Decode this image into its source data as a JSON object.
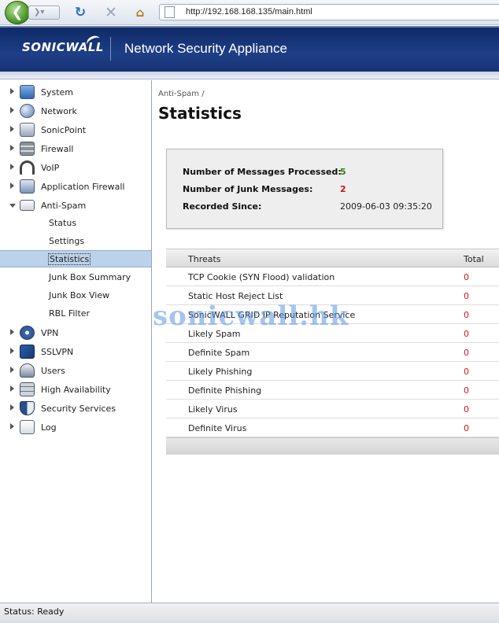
{
  "browser": {
    "address": "http://192.168.168.135/main.html"
  },
  "header": {
    "logo": "SONICWALL",
    "title": "Network Security Appliance"
  },
  "sidebar": {
    "items": [
      {
        "label": "System",
        "icon": "monitor-icon",
        "expanded": false
      },
      {
        "label": "Network",
        "icon": "globe-icon",
        "expanded": false
      },
      {
        "label": "SonicPoint",
        "icon": "access-point-icon",
        "expanded": false
      },
      {
        "label": "Firewall",
        "icon": "firewall-icon",
        "expanded": false
      },
      {
        "label": "VoIP",
        "icon": "headset-icon",
        "expanded": false
      },
      {
        "label": "Application Firewall",
        "icon": "app-firewall-icon",
        "expanded": false
      },
      {
        "label": "Anti-Spam",
        "icon": "mail-icon",
        "expanded": true
      },
      {
        "label": "VPN",
        "icon": "lock-icon",
        "expanded": false
      },
      {
        "label": "SSLVPN",
        "icon": "sslvpn-icon",
        "expanded": false
      },
      {
        "label": "Users",
        "icon": "users-icon",
        "expanded": false
      },
      {
        "label": "High Availability",
        "icon": "server-icon",
        "expanded": false
      },
      {
        "label": "Security Services",
        "icon": "shield-icon",
        "expanded": false
      },
      {
        "label": "Log",
        "icon": "log-search-icon",
        "expanded": false
      }
    ],
    "antispam_children": [
      {
        "label": "Status",
        "active": false
      },
      {
        "label": "Settings",
        "active": false
      },
      {
        "label": "Statistics",
        "active": true
      },
      {
        "label": "Junk Box Summary",
        "active": false
      },
      {
        "label": "Junk Box View",
        "active": false
      },
      {
        "label": "RBL Filter",
        "active": false
      }
    ]
  },
  "content": {
    "breadcrumb": "Anti-Spam /",
    "title": "Statistics",
    "summary": {
      "processed_label": "Number of Messages Processed:",
      "processed_value": "5",
      "junk_label": "Number of Junk Messages:",
      "junk_value": "2",
      "since_label": "Recorded Since:",
      "since_value": "2009-06-03 09:35:20"
    },
    "table": {
      "header_threats": "Threats",
      "header_total": "Total",
      "rows": [
        {
          "name": "TCP Cookie (SYN Flood) validation",
          "total": "0"
        },
        {
          "name": "Static Host Reject List",
          "total": "0"
        },
        {
          "name": "SonicWALL GRID IP Reputation Service",
          "total": "0"
        },
        {
          "name": "Likely Spam",
          "total": "0"
        },
        {
          "name": "Definite Spam",
          "total": "0"
        },
        {
          "name": "Likely Phishing",
          "total": "0"
        },
        {
          "name": "Definite Phishing",
          "total": "0"
        },
        {
          "name": "Likely Virus",
          "total": "0"
        },
        {
          "name": "Definite Virus",
          "total": "0"
        }
      ]
    },
    "watermark": "sonicwall.hk"
  },
  "status_bar": {
    "text": "Status: Ready"
  },
  "colors": {
    "processed_value": "#2e7d1e",
    "junk_value": "#c41a1a",
    "threat_total": "#cc1a1a",
    "selected_row": "#bcd1ea",
    "banner": "#1e3e86"
  }
}
